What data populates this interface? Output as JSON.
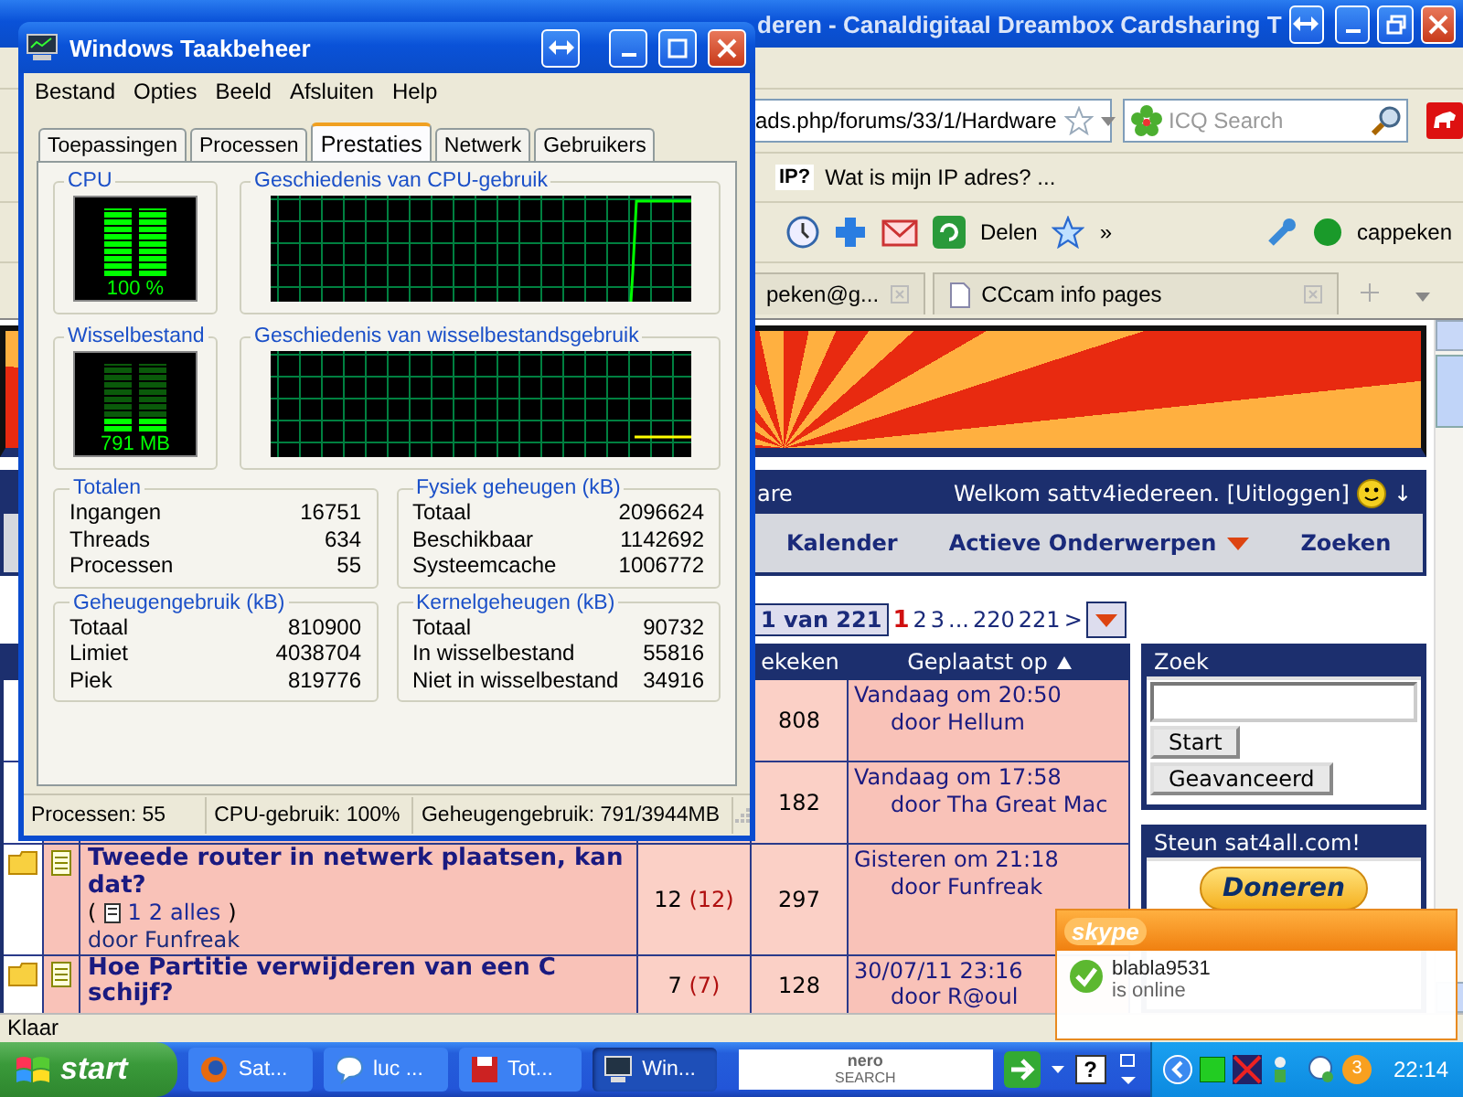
{
  "browser": {
    "title": "deren - Canaldigitaal Dreambox Cardsharing T",
    "address": "ads.php/forums/33/1/Hardware",
    "search_placeholder": "ICQ Search",
    "links": [
      {
        "badge": "IP?",
        "label": "Wat is mijn IP adres? ..."
      }
    ],
    "toolbar": {
      "share": "Delen",
      "more": "»",
      "user": "cappeken"
    },
    "tabs": [
      {
        "label": "peken@g...",
        "selected": false
      },
      {
        "label": "CCcam info pages",
        "selected": false
      }
    ],
    "status": "Klaar"
  },
  "forum": {
    "nav": {
      "section": "are",
      "welcome": "Welkom sattv4iedereen. [Uitloggen]",
      "arrow": "↓",
      "links": [
        {
          "label": "Kalender",
          "dropdown": false
        },
        {
          "label": "Actieve Onderwerpen",
          "dropdown": true
        },
        {
          "label": "Zoeken",
          "dropdown": false
        }
      ]
    },
    "pagination": {
      "summary": "1 van 221",
      "pages": [
        {
          "label": "1",
          "selected": true
        },
        {
          "label": "2",
          "selected": false
        },
        {
          "label": "3",
          "selected": false
        },
        {
          "label": "...",
          "selected": false
        },
        {
          "label": "220",
          "selected": false
        },
        {
          "label": "221",
          "selected": false
        },
        {
          "label": ">",
          "selected": false
        }
      ]
    },
    "columns": [
      {
        "label": "ekeken",
        "sorted": false
      },
      {
        "label": "Geplaatst op",
        "sorted": true
      }
    ],
    "topics": [
      {
        "views": "808",
        "last_post": "Vandaag om 20:50",
        "last_by": "door Hellum"
      },
      {
        "views": "182",
        "last_post": "Vandaag om 17:58",
        "last_by": "door Tha Great Mac"
      },
      {
        "title": "Tweede router in netwerk plaatsen, kan dat?",
        "pages_open": "(",
        "pages": [
          "1",
          "2",
          "alles"
        ],
        "pages_close": ")",
        "author": "door Funfreak",
        "replies": "12",
        "new_replies": "(12)",
        "views": "297",
        "last_post": "Gisteren om 21:18",
        "last_by": "door Funfreak"
      },
      {
        "title": "Hoe Partitie verwijderen van een C schijf?",
        "replies": "7",
        "new_replies": "(7)",
        "views": "128",
        "last_post": "30/07/11 23:16",
        "last_by": "door R@oul"
      }
    ],
    "search": {
      "title": "Zoek",
      "buttons": [
        "Start",
        "Geavanceerd"
      ]
    },
    "donate": {
      "title": "Steun sat4all.com!",
      "button": "Doneren"
    }
  },
  "task_manager": {
    "title": "Windows Taakbeheer",
    "menu": [
      "Bestand",
      "Opties",
      "Beeld",
      "Afsluiten",
      "Help"
    ],
    "tabs": [
      {
        "label": "Toepassingen",
        "selected": false
      },
      {
        "label": "Processen",
        "selected": false
      },
      {
        "label": "Prestaties",
        "selected": true
      },
      {
        "label": "Netwerk",
        "selected": false
      },
      {
        "label": "Gebruikers",
        "selected": false
      }
    ],
    "cpu": {
      "label": "CPU",
      "reading": "100 %",
      "level": 1
    },
    "cpu_history": {
      "label": "Geschiedenis van CPU-gebruik"
    },
    "pagefile": {
      "label": "Wisselbestand",
      "reading": "791 MB",
      "level": 0.2
    },
    "pagefile_history": {
      "label": "Geschiedenis van wisselbestandsgebruik"
    },
    "groups": [
      {
        "title": "Totalen",
        "rows": [
          {
            "label": "Ingangen",
            "value": "16751"
          },
          {
            "label": "Threads",
            "value": "634"
          },
          {
            "label": "Processen",
            "value": "55"
          }
        ]
      },
      {
        "title": "Fysiek geheugen (kB)",
        "rows": [
          {
            "label": "Totaal",
            "value": "2096624"
          },
          {
            "label": "Beschikbaar",
            "value": "1142692"
          },
          {
            "label": "Systeemcache",
            "value": "1006772"
          }
        ]
      },
      {
        "title": "Geheugengebruik (kB)",
        "rows": [
          {
            "label": "Totaal",
            "value": "810900"
          },
          {
            "label": "Limiet",
            "value": "4038704"
          },
          {
            "label": "Piek",
            "value": "819776"
          }
        ]
      },
      {
        "title": "Kernelgeheugen (kB)",
        "rows": [
          {
            "label": "Totaal",
            "value": "90732"
          },
          {
            "label": "In wisselbestand",
            "value": "55816"
          },
          {
            "label": "Niet in wisselbestand",
            "value": "34916"
          }
        ]
      }
    ],
    "status": [
      "Processen: 55",
      "CPU-gebruik: 100%",
      "Geheugengebruik: 791/3944MB"
    ]
  },
  "skype": {
    "logo": "skype",
    "contact": "blabla9531",
    "status": "is online"
  },
  "taskbar": {
    "start": "start",
    "tasks": [
      {
        "label": "Sat...",
        "kind": "browser",
        "selected": false
      },
      {
        "label": "luc ...",
        "kind": "chat",
        "selected": false
      },
      {
        "label": "Tot...",
        "kind": "disk",
        "selected": false
      },
      {
        "label": "Win...",
        "kind": "monitor",
        "selected": true
      }
    ],
    "search_logo": [
      "nero",
      "SEARCH"
    ],
    "help": "?",
    "tray_badge": "3",
    "clock": "22:14"
  }
}
